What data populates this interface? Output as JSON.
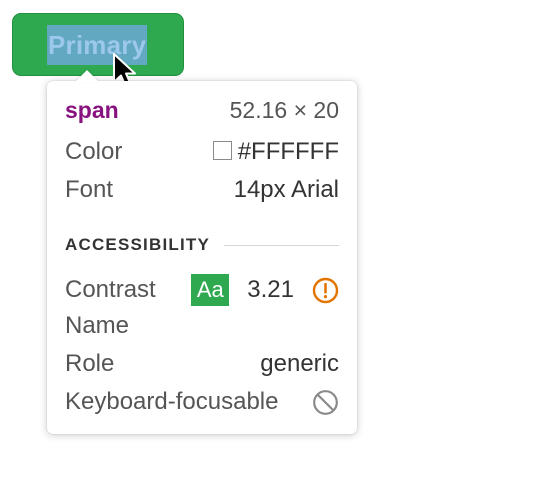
{
  "button": {
    "label": "Primary",
    "background_color": "#2ea94f"
  },
  "cursor": {
    "icon": "arrow-cursor-icon"
  },
  "tooltip": {
    "element": {
      "tag": "span",
      "dimensions": "52.16 × 20"
    },
    "color": {
      "label": "Color",
      "value": "#FFFFFF",
      "swatch_color": "#FFFFFF"
    },
    "font": {
      "label": "Font",
      "value": "14px Arial"
    },
    "accessibility": {
      "title": "ACCESSIBILITY",
      "contrast": {
        "label": "Contrast",
        "badge": "Aa",
        "ratio": "3.21",
        "warning_icon": "warning-circle-icon",
        "warning_color": "#e37400"
      },
      "name": {
        "label": "Name",
        "value": ""
      },
      "role": {
        "label": "Role",
        "value": "generic"
      },
      "keyboard_focusable": {
        "label": "Keyboard-focusable",
        "icon": "not-allowed-icon"
      }
    }
  }
}
